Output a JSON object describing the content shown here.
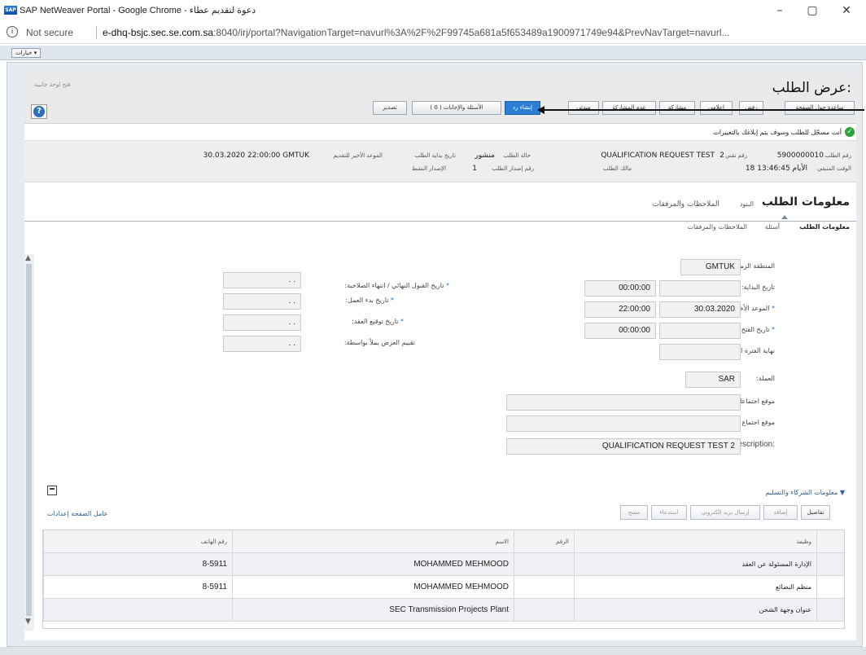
{
  "window": {
    "title": "SAP NetWeaver Portal - Google Chrome - دعوة لتقديم عطاء",
    "app_icon": "sap-logo-icon",
    "minimize": "–",
    "maximize": "▢",
    "close": "✕"
  },
  "address_bar": {
    "security_label": "Not secure",
    "url_domain": "e-dhq-bsjc.sec.se.com.sa",
    "url_rest": ":8040/irj/portal?NavigationTarget=navurl%3A%2F%2F99745a681a5f653489a1900971749e94&PrevNavTarget=navurl..."
  },
  "portal": {
    "options_button": "خيارات ▾"
  },
  "header": {
    "page_title": "عرض الطلب:",
    "help_link": "فتح لوحة جانبية",
    "toolbar_buttons": [
      {
        "label": "ساعدة حول الصفحة",
        "active": false
      },
      {
        "label": "رفض",
        "active": false
      },
      {
        "label": "إعلامي",
        "active": false
      },
      {
        "label": "مشاركة",
        "active": false
      },
      {
        "label": "عدم المشاركة",
        "active": false
      },
      {
        "label": "مبدئي",
        "active": false
      },
      {
        "label": "إنشاء رد",
        "active": true
      },
      {
        "label": "الأسئلة والإجابات ( 0 )",
        "active": false
      },
      {
        "label": "تصدير",
        "active": false
      }
    ]
  },
  "message": {
    "text": "أنت مسجّل للطلب وسوف يتم إبلاغك بالتغييرات"
  },
  "summary": {
    "request_no_label": "رقم الطلب",
    "request_no": "5900000010",
    "tech_no_label": "رقم تقني",
    "tech_no": "2",
    "request_name": "QUALIFICATION REQUEST TEST",
    "status_label": "حالة الطلب",
    "status": "منشور",
    "start_label": "تاريخ بداية الطلب",
    "deadline_label": "الموعد الأخير للتقديم",
    "deadline": "30.03.2020 22:00:00 GMTUK",
    "remaining_label": "الوقت المتبقي",
    "remaining": "18 الأيام 13:46:45",
    "owner_label": "مالك الطلب",
    "version_label": "رقم إصدار الطلب",
    "version": "1",
    "active_version_label": "رقم إصدار الطلب",
    "active_label": "الإصدار النشط"
  },
  "tabs": {
    "main": "معلومات الطلب",
    "items": "البنود",
    "notes": "الملاحظات والمرفقات",
    "sub": [
      "معلومات الطلب",
      "أسئلة",
      "الملاحظات والمرفقات"
    ]
  },
  "form": {
    "timezone_label": "المنطقة الزمنية:",
    "timezone": "GMTUK",
    "start_date_label": "تاريخ البداية:",
    "start_time": "00:00:00",
    "deadline_label": "الموعد الأخير للتقديم:",
    "deadline_date": "30.03.2020",
    "deadline_time": "22:00:00",
    "open_date_label": "تاريخ الفتح:",
    "open_time": "00:00:00",
    "binding_label": "نهاية الفترة الملزمة:",
    "currency_label": "العملة:",
    "currency": "SAR",
    "opening_loc_label": "موقع اجتماعات فتح العرض:",
    "start_meeting_label": "موقع اجتماع تاريخ بداية:",
    "arabic_desc_label": ":Arabic Description",
    "arabic_desc": "QUALIFICATION REQUEST TEST 2",
    "final_accept_label": "تاريخ القبول النهائي / انتهاء الصلاحية:",
    "work_start_label": "تاريخ بدء العمل:",
    "contract_sign_label": "تاريخ توقيع العقد:",
    "eval_label": "تقييم العرض يملأ بواسطة:",
    "date_placeholder": ". ."
  },
  "partners": {
    "section_title": "معلومات الشركاء والتسليم",
    "page_settings": "عامل الصفحة إعدادات",
    "toolbar": [
      {
        "label": "تفاصيل",
        "enabled": true
      },
      {
        "label": "إضافة",
        "enabled": false
      },
      {
        "label": "إرسال بريد إلكتروني",
        "enabled": false
      },
      {
        "label": "استدعاء",
        "enabled": false
      },
      {
        "label": "مسح",
        "enabled": false
      }
    ],
    "columns": [
      "وظيفة",
      "الرقم",
      "الاسم",
      "رقم الهاتف"
    ],
    "rows": [
      {
        "function": "الإدارة المسئولة عن العقد",
        "number": "",
        "name": "MOHAMMED MEHMOOD",
        "phone": "8-5911"
      },
      {
        "function": "منظم البضائع",
        "number": "",
        "name": "MOHAMMED MEHMOOD",
        "phone": "8-5911"
      },
      {
        "function": "عنوان وجهة الشحن",
        "number": "",
        "name": "SEC Transmission Projects Plant",
        "phone": ""
      }
    ]
  }
}
